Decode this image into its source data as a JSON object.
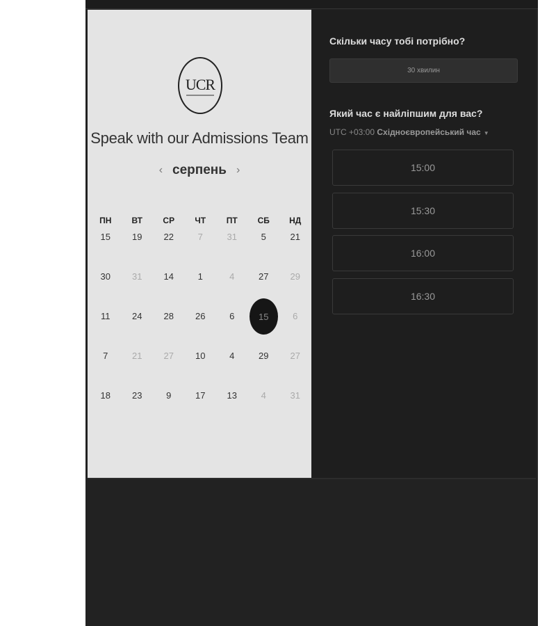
{
  "logo": {
    "text": "UCR"
  },
  "title": "Speak with our Admissions Team",
  "calendar": {
    "month": "серпень",
    "weekdays": [
      "ПН",
      "ВТ",
      "СР",
      "ЧТ",
      "ПТ",
      "СБ",
      "НД"
    ],
    "weeks": [
      [
        {
          "d": "15",
          "a": true
        },
        {
          "d": "19",
          "a": true
        },
        {
          "d": "22",
          "a": true
        },
        {
          "d": "7",
          "a": false
        },
        {
          "d": "31",
          "a": false
        },
        {
          "d": "5",
          "a": true
        },
        {
          "d": "21",
          "a": true
        }
      ],
      [
        {
          "d": "30",
          "a": true
        },
        {
          "d": "31",
          "a": false
        },
        {
          "d": "14",
          "a": true
        },
        {
          "d": "1",
          "a": true
        },
        {
          "d": "4",
          "a": false
        },
        {
          "d": "27",
          "a": true
        },
        {
          "d": "29",
          "a": false
        }
      ],
      [
        {
          "d": "11",
          "a": true
        },
        {
          "d": "24",
          "a": true
        },
        {
          "d": "28",
          "a": true
        },
        {
          "d": "26",
          "a": true
        },
        {
          "d": "6",
          "a": true
        },
        {
          "d": "15",
          "a": true,
          "selected": true
        },
        {
          "d": "6",
          "a": false
        }
      ],
      [
        {
          "d": "7",
          "a": true
        },
        {
          "d": "21",
          "a": false
        },
        {
          "d": "27",
          "a": false
        },
        {
          "d": "10",
          "a": true
        },
        {
          "d": "4",
          "a": true
        },
        {
          "d": "29",
          "a": true
        },
        {
          "d": "27",
          "a": false
        }
      ],
      [
        {
          "d": "18",
          "a": true
        },
        {
          "d": "23",
          "a": true
        },
        {
          "d": "9",
          "a": true
        },
        {
          "d": "17",
          "a": true
        },
        {
          "d": "13",
          "a": true
        },
        {
          "d": "4",
          "a": false
        },
        {
          "d": "31",
          "a": false
        }
      ]
    ]
  },
  "booking": {
    "duration_question": "Скільки часу тобі потрібно?",
    "duration_value": "30 хвилин",
    "time_question": "Який час є найліпшим для вас?",
    "tz_offset": "UTC +03:00",
    "tz_name": "Східноєвропейський час",
    "slots": [
      "15:00",
      "15:30",
      "16:00",
      "16:30"
    ]
  }
}
